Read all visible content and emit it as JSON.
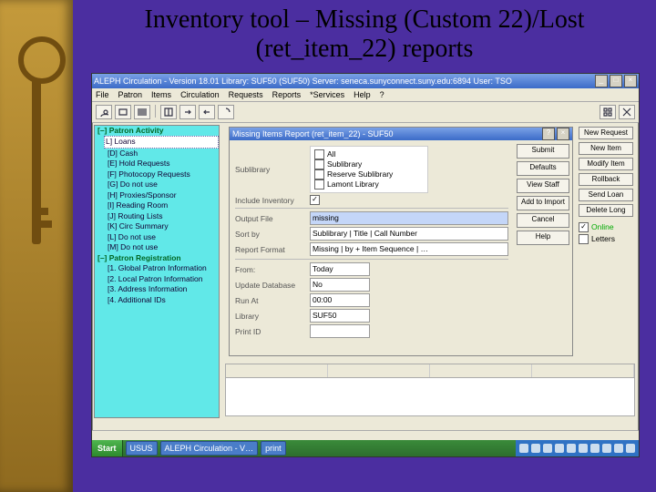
{
  "slide": {
    "title": "Inventory tool – Missing (Custom 22)/Lost (ret_item_22) reports"
  },
  "app": {
    "title": "ALEPH Circulation - Version 18.01  Library: SUF50 (SUF50)  Server: seneca.sunyconnect.suny.edu:6894  User: TSO",
    "menus": [
      "File",
      "Patron",
      "Items",
      "Circulation",
      "Requests",
      "Reports",
      "*Services",
      "Help",
      "?"
    ],
    "toolbar_icons": [
      "user-icon",
      "id-icon",
      "barcode-icon",
      "divider",
      "book-icon",
      "arrow-right-icon",
      "arrow-left-icon",
      "help-icon"
    ],
    "right_toolbar_icons": [
      "tile-icon",
      "close-x-icon"
    ]
  },
  "tree": {
    "section1": "Patron Activity",
    "items1": [
      "Loans",
      "Cash",
      "Hold Requests",
      "Photocopy Requests",
      "Do not use",
      "Proxies/Sponsor",
      "Reading Room",
      "Routing Lists",
      "Circ Summary",
      "Do not use",
      "Do not use"
    ],
    "section2": "Patron Registration",
    "items2": [
      "Global Patron Information",
      "Local Patron Information",
      "Address Information",
      "Additional IDs"
    ]
  },
  "dialog": {
    "title": "Missing Items Report (ret_item_22) - SUF50",
    "labels": {
      "sublibrary": "Sublibrary",
      "include_inventory": "Include Inventory",
      "output": "Output File",
      "sortby": "Sort by",
      "format": "Report Format",
      "from": "From:",
      "update": "Update Database",
      "runat": "Run At",
      "library": "Library",
      "printid": "Print ID"
    },
    "chk_opts": [
      "All",
      "Sublibrary",
      "Reserve Sublibrary",
      "Lamont Library"
    ],
    "chk_states": [
      false,
      false,
      false,
      false
    ],
    "include_inventory_checked": true,
    "output_value": "missing",
    "sortby_value": "Sublibrary | Title | Call Number",
    "format_value": "Missing | by + Item Sequence | …",
    "from_value": "Today",
    "update_value": "No",
    "runat_value": "00:00",
    "library_value": "SUF50",
    "printid_value": ""
  },
  "dlg_btns": [
    "Submit",
    "Defaults",
    "View Staff",
    "Add to Import",
    "Cancel",
    "Help"
  ],
  "right_panel": {
    "btns": [
      "New Request",
      "New Item",
      "Modify Item",
      "Rollback",
      "Send Loan",
      "Delete Long"
    ],
    "checks": [
      {
        "label": "Online",
        "on": true,
        "color": "#0a0"
      },
      {
        "label": "Letters",
        "on": false,
        "color": "#000"
      }
    ]
  },
  "list_headers": [
    "",
    "",
    "",
    ""
  ],
  "taskbar": {
    "start": "Start",
    "tasks": [
      "USUS",
      "ALEPH Circulation - V…",
      "print"
    ],
    "tray_icons": 10
  }
}
